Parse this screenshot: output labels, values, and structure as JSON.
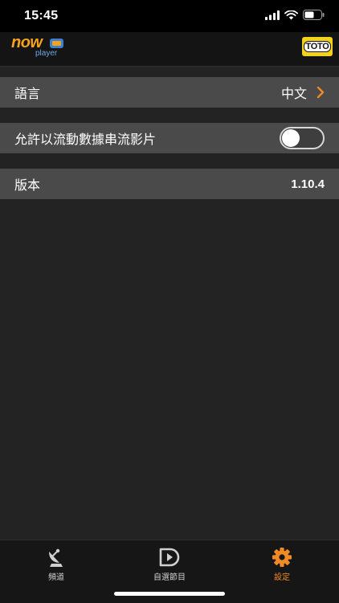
{
  "status_bar": {
    "time": "15:45"
  },
  "header": {
    "logo_now": "now",
    "logo_player": "player",
    "badge_text": "TOTO"
  },
  "settings": {
    "language": {
      "label": "語言",
      "value": "中文"
    },
    "streaming": {
      "label": "允許以流動數據串流影片",
      "enabled": false
    },
    "version": {
      "label": "版本",
      "value": "1.10.4"
    }
  },
  "tabs": [
    {
      "label": "頻道",
      "icon": "satellite-dish-icon",
      "active": false
    },
    {
      "label": "自選節目",
      "icon": "play-circle-icon",
      "active": false
    },
    {
      "label": "設定",
      "icon": "gear-icon",
      "active": true
    }
  ],
  "colors": {
    "accent": "#f08a24",
    "row_background": "#4a4a4a",
    "page_background": "#232323"
  }
}
